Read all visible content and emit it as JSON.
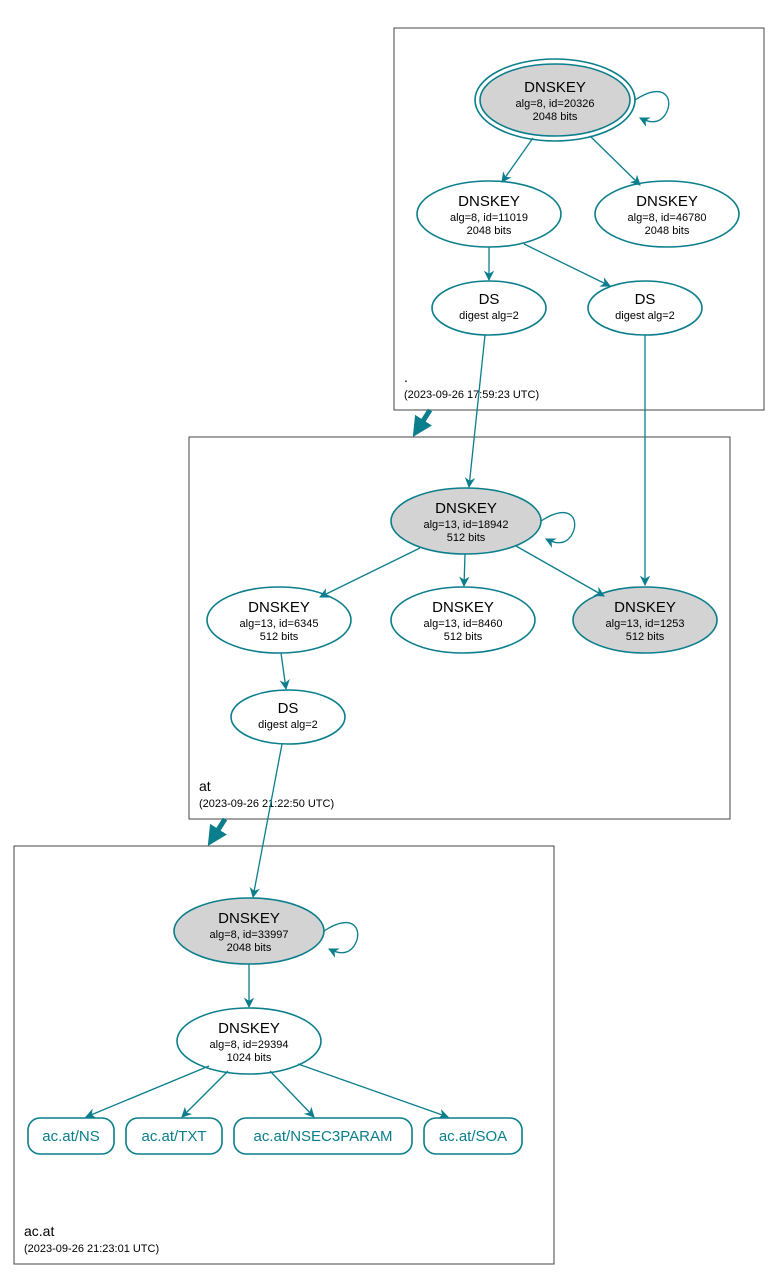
{
  "colors": {
    "stroke": "#0a7e8c",
    "shaded": "#d3d3d3"
  },
  "zones": {
    "root": {
      "label": ".",
      "time": "(2023-09-26 17:59:23 UTC)"
    },
    "at": {
      "label": "at",
      "time": "(2023-09-26 21:22:50 UTC)"
    },
    "acat": {
      "label": "ac.at",
      "time": "(2023-09-26 21:23:01 UTC)"
    }
  },
  "nodes": {
    "root_ksk": {
      "title": "DNSKEY",
      "l1": "alg=8, id=20326",
      "l2": "2048 bits"
    },
    "root_zsk1": {
      "title": "DNSKEY",
      "l1": "alg=8, id=11019",
      "l2": "2048 bits"
    },
    "root_zsk2": {
      "title": "DNSKEY",
      "l1": "alg=8, id=46780",
      "l2": "2048 bits"
    },
    "root_ds1": {
      "title": "DS",
      "l1": "digest alg=2"
    },
    "root_ds2": {
      "title": "DS",
      "l1": "digest alg=2"
    },
    "at_ksk": {
      "title": "DNSKEY",
      "l1": "alg=13, id=18942",
      "l2": "512 bits"
    },
    "at_z1": {
      "title": "DNSKEY",
      "l1": "alg=13, id=6345",
      "l2": "512 bits"
    },
    "at_z2": {
      "title": "DNSKEY",
      "l1": "alg=13, id=8460",
      "l2": "512 bits"
    },
    "at_z3": {
      "title": "DNSKEY",
      "l1": "alg=13, id=1253",
      "l2": "512 bits"
    },
    "at_ds": {
      "title": "DS",
      "l1": "digest alg=2"
    },
    "ac_ksk": {
      "title": "DNSKEY",
      "l1": "alg=8, id=33997",
      "l2": "2048 bits"
    },
    "ac_zsk": {
      "title": "DNSKEY",
      "l1": "alg=8, id=29394",
      "l2": "1024 bits"
    }
  },
  "records": {
    "ns": "ac.at/NS",
    "txt": "ac.at/TXT",
    "nsec": "ac.at/NSEC3PARAM",
    "soa": "ac.at/SOA"
  }
}
